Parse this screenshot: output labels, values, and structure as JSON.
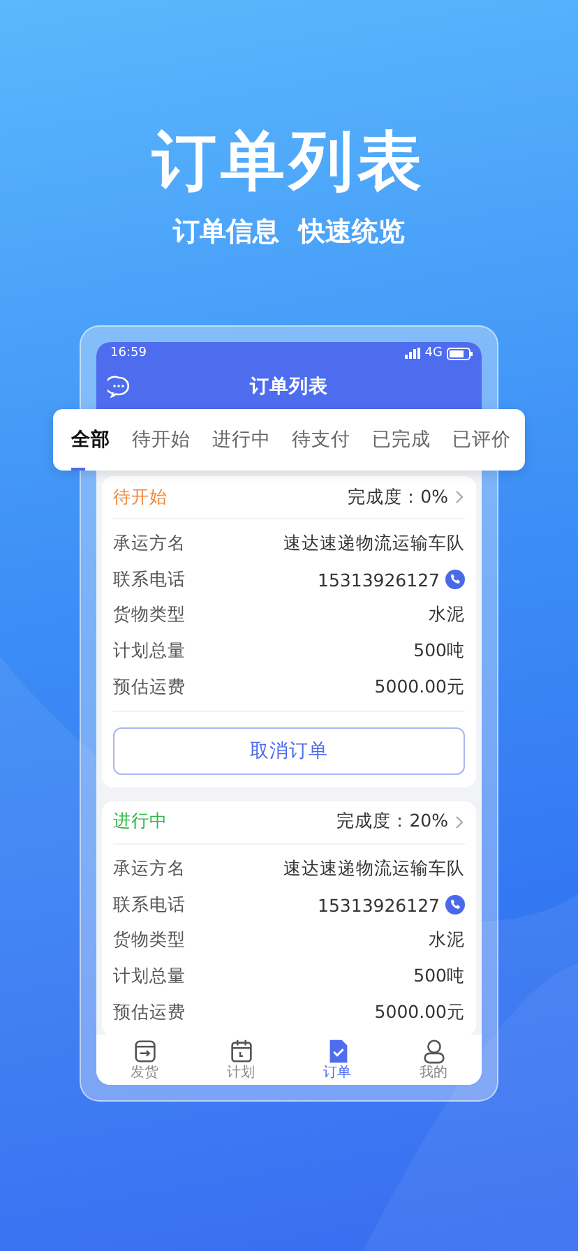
{
  "hero": {
    "title": "订单列表",
    "subtitle_parts": [
      "订单信息",
      "快速统览"
    ]
  },
  "status_bar": {
    "time": "16:59",
    "network": "4G"
  },
  "app_bar": {
    "title": "订单列表"
  },
  "tabs": [
    {
      "label": "全部",
      "selected": true
    },
    {
      "label": "待开始",
      "selected": false
    },
    {
      "label": "进行中",
      "selected": false
    },
    {
      "label": "待支付",
      "selected": false
    },
    {
      "label": "已完成",
      "selected": false
    },
    {
      "label": "已评价",
      "selected": false
    }
  ],
  "orders": [
    {
      "status": "待开始",
      "color": "#f0883a",
      "progress": "完成度：0%",
      "fields": [
        {
          "kind": "text",
          "label": "承运方名",
          "value": "速达速递物流运输车队"
        },
        {
          "kind": "phone",
          "label": "联系电话",
          "value": "15313926127"
        },
        {
          "kind": "text",
          "label": "货物类型",
          "value": "水泥"
        },
        {
          "kind": "text",
          "label": "计划总量",
          "value": "500吨"
        },
        {
          "kind": "text",
          "label": "预估运费",
          "value": "5000.00元"
        }
      ],
      "action": "取消订单"
    },
    {
      "status": "进行中",
      "color": "#2bb845",
      "progress": "完成度：20%",
      "fields": [
        {
          "kind": "text",
          "label": "承运方名",
          "value": "速达速递物流运输车队"
        },
        {
          "kind": "phone",
          "label": "联系电话",
          "value": "15313926127"
        },
        {
          "kind": "text",
          "label": "货物类型",
          "value": "水泥"
        },
        {
          "kind": "text",
          "label": "计划总量",
          "value": "500吨"
        },
        {
          "kind": "text",
          "label": "预估运费",
          "value": "5000.00元"
        }
      ]
    }
  ],
  "nav": [
    {
      "kind": "ship",
      "label": "发货",
      "selected": false
    },
    {
      "kind": "plan",
      "label": "计划",
      "selected": false
    },
    {
      "kind": "order",
      "label": "订单",
      "selected": true
    },
    {
      "kind": "me",
      "label": "我的",
      "selected": false
    }
  ]
}
